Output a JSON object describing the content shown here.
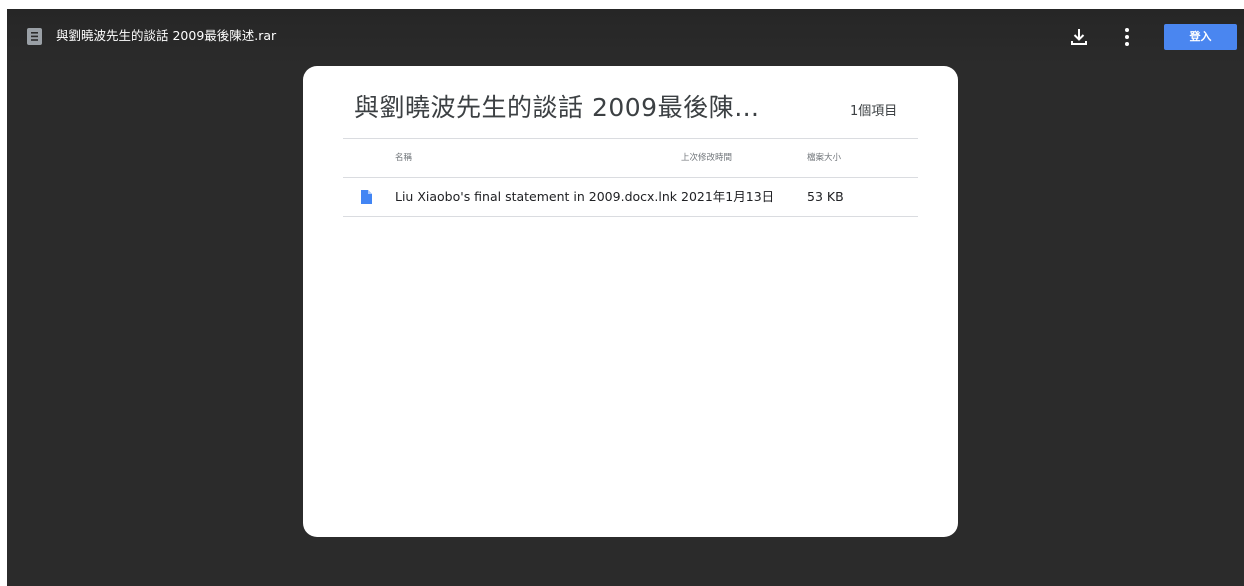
{
  "header": {
    "file_name": "與劉曉波先生的談話 2009最後陳述.rar",
    "login_label": "登入",
    "file_icon": "archive-file-icon",
    "download_icon": "download-icon",
    "more_icon": "more-vert-icon"
  },
  "archive": {
    "title": "與劉曉波先生的談話 2009最後陳…",
    "item_count": "1個項目",
    "columns": {
      "name": "名稱",
      "modified": "上次修改時間",
      "size": "檔案大小"
    },
    "items": [
      {
        "name": "Liu Xiaobo's final statement in 2009.docx.lnk",
        "modified": "2021年1月13日",
        "size": "53 KB",
        "icon": "document-icon"
      }
    ]
  },
  "colors": {
    "background": "#2b2b2b",
    "accent": "#4a86f0",
    "doc_icon": "#4285f4"
  }
}
